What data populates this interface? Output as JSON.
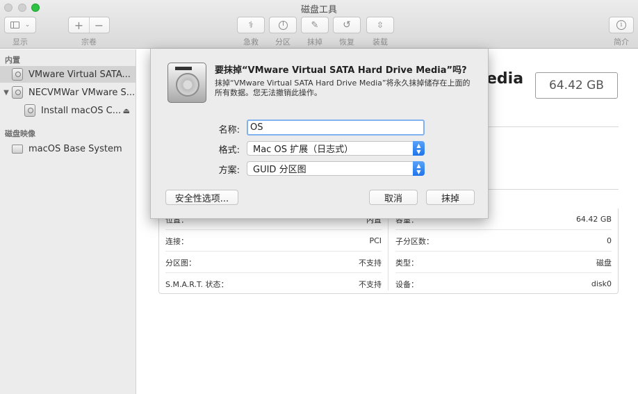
{
  "window": {
    "title": "磁盘工具"
  },
  "toolbar": {
    "view_label": "显示",
    "volume_label": "宗卷",
    "add_symbol": "+",
    "remove_symbol": "−",
    "first_aid_label": "急救",
    "partition_label": "分区",
    "erase_label": "抹掉",
    "restore_label": "恢复",
    "mount_label": "装载",
    "info_label": "简介"
  },
  "sidebar": {
    "internal_heading": "内置",
    "images_heading": "磁盘映像",
    "items": [
      {
        "label": "VMware Virtual SATA...",
        "selected": true
      },
      {
        "label": "NECVMWar VMware S..."
      },
      {
        "label": "Install macOS C..."
      },
      {
        "label": "macOS Base System"
      }
    ]
  },
  "main": {
    "title_partial": "edia",
    "size": "64.42 GB",
    "info": {
      "left": [
        {
          "key": "位置：",
          "value": "内置"
        },
        {
          "key": "连接：",
          "value": "PCI"
        },
        {
          "key": "分区图：",
          "value": "不支持"
        },
        {
          "key": "S.M.A.R.T. 状态：",
          "value": "不支持"
        }
      ],
      "right": [
        {
          "key": "容量：",
          "value": "64.42 GB"
        },
        {
          "key": "子分区数：",
          "value": "0"
        },
        {
          "key": "类型：",
          "value": "磁盘"
        },
        {
          "key": "设备：",
          "value": "disk0"
        }
      ]
    }
  },
  "dialog": {
    "title": "要抹掉“VMware Virtual SATA Hard Drive Media”吗?",
    "description": "抹掉“VMware Virtual SATA Hard Drive Media”将永久抹掉储存在上面的所有数据。您无法撤销此操作。",
    "name_label": "名称:",
    "name_value": "OS",
    "format_label": "格式:",
    "format_value": "Mac OS 扩展（日志式）",
    "scheme_label": "方案:",
    "scheme_value": "GUID 分区图",
    "security_button": "安全性选项...",
    "cancel_button": "取消",
    "erase_button": "抹掉"
  }
}
